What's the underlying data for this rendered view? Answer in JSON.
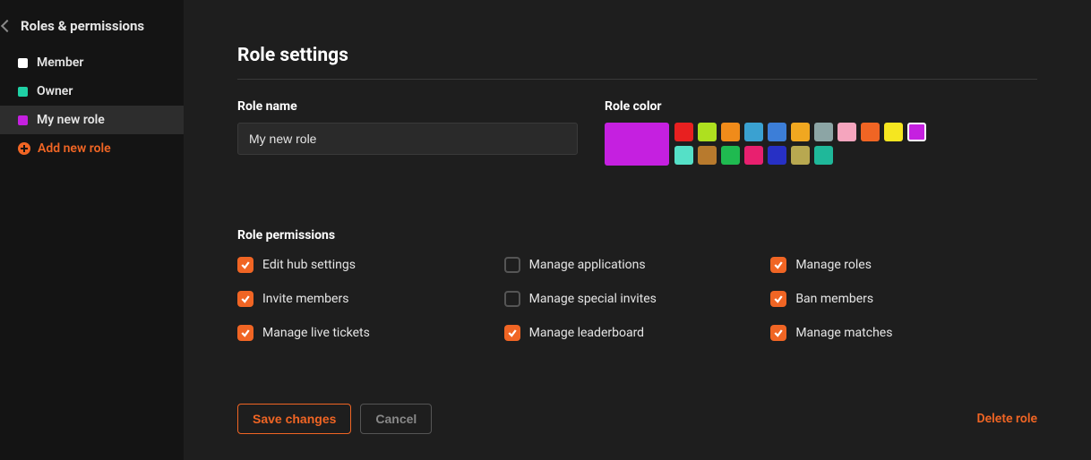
{
  "sidebar": {
    "title": "Roles & permissions",
    "roles": [
      {
        "label": "Member",
        "color": "#ffffff",
        "selected": false
      },
      {
        "label": "Owner",
        "color": "#1fd1a5",
        "selected": false
      },
      {
        "label": "My new role",
        "color": "#c520e0",
        "selected": true
      }
    ],
    "add_label": "Add new role"
  },
  "main": {
    "title": "Role settings",
    "role_name_label": "Role name",
    "role_name_value": "My new role",
    "role_color_label": "Role color",
    "selected_color": "#c520e0",
    "color_swatches": [
      "#e82020",
      "#aee01f",
      "#f08b1a",
      "#3aa1d1",
      "#3c7ed8",
      "#f0a720",
      "#8ca5a5",
      "#f5a5be",
      "#f06524",
      "#f5e620",
      "#c520e0",
      "#55e0c7",
      "#b87a2d",
      "#1fba50",
      "#e8206f",
      "#2730c5",
      "#b8a850",
      "#1fb89a"
    ],
    "selected_swatch_index": 10,
    "permissions_label": "Role permissions",
    "permissions": [
      {
        "label": "Edit hub settings",
        "checked": true
      },
      {
        "label": "Manage applications",
        "checked": false
      },
      {
        "label": "Manage roles",
        "checked": true
      },
      {
        "label": "Invite members",
        "checked": true
      },
      {
        "label": "Manage special invites",
        "checked": false
      },
      {
        "label": "Ban members",
        "checked": true
      },
      {
        "label": "Manage live tickets",
        "checked": true
      },
      {
        "label": "Manage leaderboard",
        "checked": true
      },
      {
        "label": "Manage matches",
        "checked": true
      }
    ],
    "save_label": "Save changes",
    "cancel_label": "Cancel",
    "delete_label": "Delete role"
  }
}
